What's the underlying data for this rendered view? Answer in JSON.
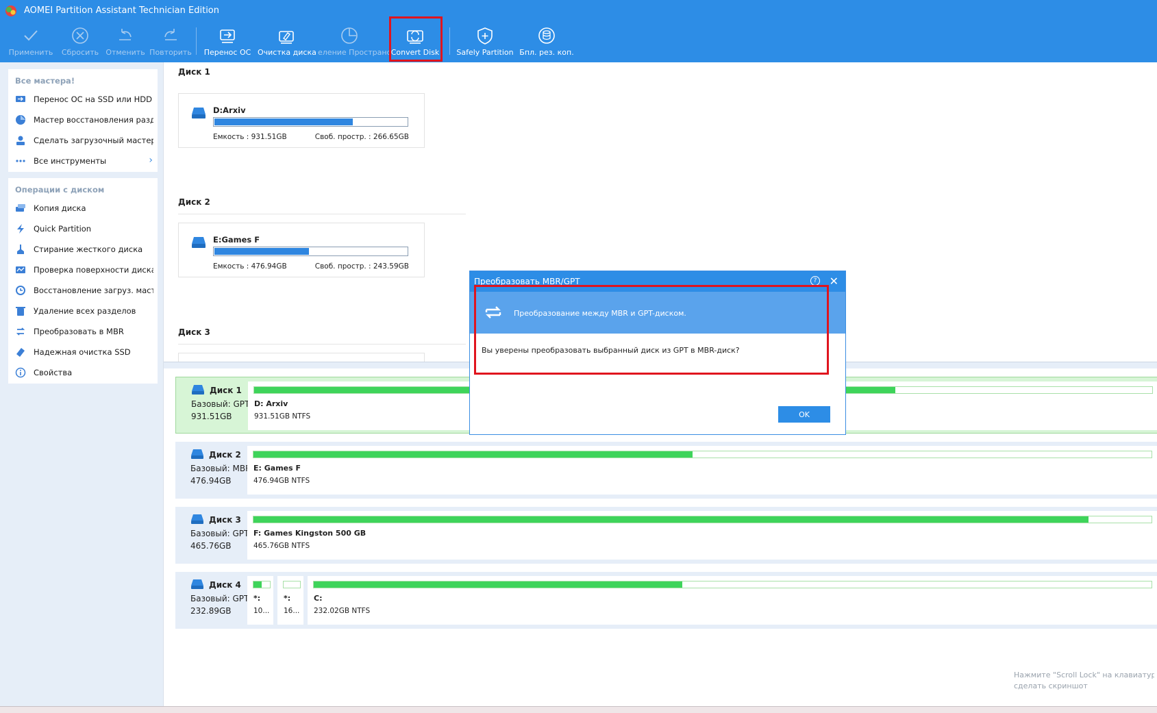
{
  "window": {
    "title": "AOMEI Partition Assistant Technician Edition"
  },
  "toolbar": {
    "buttons": [
      {
        "label": "Применить",
        "icon": "check-icon",
        "disabled": true
      },
      {
        "label": "Сбросить",
        "icon": "discard-icon",
        "disabled": true
      },
      {
        "label": "Отменить",
        "icon": "undo-icon",
        "disabled": true
      },
      {
        "label": "Повторить",
        "icon": "redo-icon",
        "disabled": true
      },
      {
        "label": "Перенос ОС",
        "icon": "migrate-os-icon",
        "disabled": false
      },
      {
        "label": "Очистка диска",
        "icon": "disk-cleanup-icon",
        "disabled": false
      },
      {
        "label": "еление Пространс",
        "icon": "allocate-space-icon",
        "disabled": true
      },
      {
        "label": "Convert Disk",
        "icon": "convert-disk-icon",
        "disabled": false
      },
      {
        "label": "Safely Partition",
        "icon": "safely-partition-icon",
        "disabled": false
      },
      {
        "label": "Бпл. рез. коп.",
        "icon": "backup-icon",
        "disabled": false
      }
    ]
  },
  "sidebar": {
    "wizards": {
      "title": "Все мастера!",
      "items": [
        {
          "label": "Перенос ОС на SSD или HDD",
          "icon": "migrate-os-icon"
        },
        {
          "label": "Мастер восстановления раздела",
          "icon": "partition-recovery-icon"
        },
        {
          "label": "Сделать загрузочный мастер-...",
          "icon": "bootable-media-icon"
        },
        {
          "label": "Все инструменты",
          "icon": "more-dots-icon",
          "arrow": "›"
        }
      ]
    },
    "disk_ops": {
      "title": "Операции с диском",
      "items": [
        {
          "label": "Копия диска",
          "icon": "disk-copy-icon"
        },
        {
          "label": "Quick Partition",
          "icon": "lightning-icon"
        },
        {
          "label": "Стирание жесткого диска",
          "icon": "wipe-disk-icon"
        },
        {
          "label": "Проверка поверхности диска",
          "icon": "surface-test-icon"
        },
        {
          "label": "Восстановление загруз. масте...",
          "icon": "rebuild-mbr-icon"
        },
        {
          "label": "Удаление всех разделов",
          "icon": "delete-partitions-icon"
        },
        {
          "label": "Преобразовать в MBR",
          "icon": "convert-mbr-icon"
        },
        {
          "label": "Надежная очистка SSD",
          "icon": "ssd-erase-icon"
        },
        {
          "label": "Свойства",
          "icon": "info-icon"
        }
      ]
    }
  },
  "top_disks": [
    {
      "title": "Диск 1",
      "name": "D:Arxiv",
      "capacity": "Емкость : 931.51GB",
      "free": "Своб. простр. : 266.65GB",
      "used_fraction": 0.714
    },
    {
      "title": "Диск 2",
      "name": "E:Games F",
      "capacity": "Емкость : 476.94GB",
      "free": "Своб. простр. : 243.59GB",
      "used_fraction": 0.489
    },
    {
      "title": "Диск 3"
    }
  ],
  "disk_map": [
    {
      "name": "Диск 1",
      "type": "Базовый: GPT",
      "size": "931.51GB",
      "selected": true,
      "partitions": [
        {
          "name": "D: Arxiv",
          "desc": "931.51GB NTFS",
          "used_fraction": 0.714
        }
      ]
    },
    {
      "name": "Диск 2",
      "type": "Базовый: MBR",
      "size": "476.94GB",
      "selected": false,
      "partitions": [
        {
          "name": "E: Games F",
          "desc": "476.94GB NTFS",
          "used_fraction": 0.489
        }
      ]
    },
    {
      "name": "Диск 3",
      "type": "Базовый: GPT",
      "size": "465.76GB",
      "selected": false,
      "partitions": [
        {
          "name": "F: Games Kingston 500 GB",
          "desc": "465.76GB NTFS",
          "used_fraction": 0.93
        }
      ]
    },
    {
      "name": "Диск 4",
      "type": "Базовый: GPT",
      "size": "232.89GB",
      "selected": false,
      "partitions": [
        {
          "name": "*:",
          "desc": "10...",
          "used_fraction": 0.5
        },
        {
          "name": "*:",
          "desc": "16...",
          "used_fraction": 0.0
        },
        {
          "name": "C:",
          "desc": "232.02GB NTFS",
          "used_fraction": 0.44
        }
      ]
    }
  ],
  "dialog": {
    "title": "Преобразовать MBR/GPT",
    "help": "?",
    "close": "✕",
    "banner": "Преобразование между MBR и GPT-диском.",
    "question": "Вы уверены преобразовать выбранный диск из GPT в MBR-диск?",
    "ok": "OK"
  },
  "watermark": {
    "line1": "Нажмите \"Scroll Lock\" на клавиатуре",
    "line2": "сделать скриншот"
  },
  "colors": {
    "accent": "#2d8de6",
    "highlight": "#e0141e",
    "used_bar": "#3ed45a",
    "card_bar": "#2f86e0"
  }
}
